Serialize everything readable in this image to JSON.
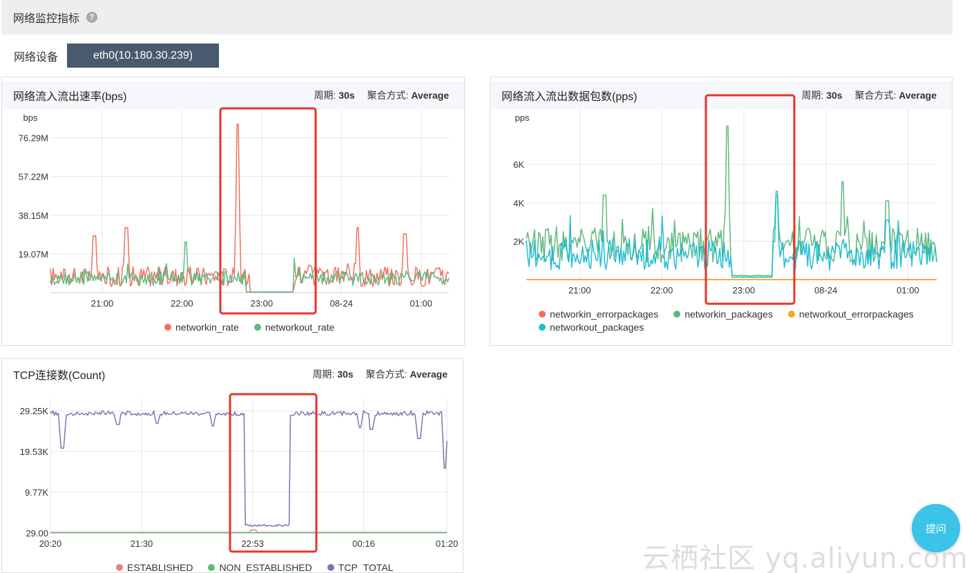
{
  "section": {
    "title": "网络监控指标",
    "help_icon": "question-circle-icon"
  },
  "device": {
    "label": "网络设备",
    "selected": "eth0(10.180.30.239)"
  },
  "panels": {
    "rate": {
      "title": "网络流入流出速率(bps)",
      "period_label": "周期:",
      "period": "30s",
      "agg_label": "聚合方式:",
      "agg": "Average",
      "legend": [
        {
          "name": "networkin_rate",
          "color": "#ef6f5e"
        },
        {
          "name": "networkout_rate",
          "color": "#5db97f"
        }
      ]
    },
    "packets": {
      "title": "网络流入流出数据包数(pps)",
      "period_label": "周期:",
      "period": "30s",
      "agg_label": "聚合方式:",
      "agg": "Average",
      "legend": [
        {
          "name": "networkin_errorpackages",
          "color": "#ef6f5e"
        },
        {
          "name": "networkin_packages",
          "color": "#5db97f"
        },
        {
          "name": "networkout_errorpackages",
          "color": "#f5a623"
        },
        {
          "name": "networkout_packages",
          "color": "#1fbcd2"
        }
      ]
    },
    "tcp": {
      "title": "TCP连接数(Count)",
      "period_label": "周期:",
      "period": "30s",
      "agg_label": "聚合方式:",
      "agg": "Average",
      "legend": [
        {
          "name": "ESTABLISHED",
          "color": "#ef7f7a"
        },
        {
          "name": "NON_ESTABLISHED",
          "color": "#5db97f"
        },
        {
          "name": "TCP_TOTAL",
          "color": "#8074b0"
        }
      ]
    }
  },
  "chart_data": [
    {
      "type": "line",
      "id": "rate",
      "ylabel": "bps",
      "y_ticks": [
        "76.29M",
        "57.22M",
        "38.15M",
        "19.07M"
      ],
      "y_tick_values": [
        76.29,
        57.22,
        38.15,
        19.07
      ],
      "ylim": [
        0,
        84
      ],
      "x_ticks": [
        "21:00",
        "22:00",
        "23:00",
        "08-24",
        "01:00"
      ],
      "x_tick_positions": [
        0.13,
        0.33,
        0.53,
        0.73,
        0.93
      ],
      "grid": true,
      "series": [
        {
          "name": "networkin_rate",
          "color": "#ef6f5e",
          "baseline": 8,
          "noise": 5,
          "spikes": [
            [
              0.11,
              28
            ],
            [
              0.19,
              32
            ],
            [
              0.47,
              83
            ],
            [
              0.77,
              32
            ],
            [
              0.89,
              29
            ]
          ],
          "dip": [
            0.5,
            0.61,
            0.3
          ]
        },
        {
          "name": "networkout_rate",
          "color": "#5db97f",
          "baseline": 7,
          "noise": 3.5,
          "spikes": [
            [
              0.34,
              25
            ],
            [
              0.61,
              17
            ]
          ],
          "dip": [
            0.49,
            0.61,
            0.3
          ]
        }
      ]
    },
    {
      "type": "line",
      "id": "packets",
      "ylabel": "pps",
      "y_ticks": [
        "6K",
        "4K",
        "2K"
      ],
      "y_tick_values": [
        6000,
        4000,
        2000
      ],
      "ylim": [
        0,
        8200
      ],
      "x_ticks": [
        "21:00",
        "22:00",
        "23:00",
        "08-24",
        "01:00"
      ],
      "x_tick_positions": [
        0.13,
        0.33,
        0.53,
        0.73,
        0.93
      ],
      "grid": true,
      "series": [
        {
          "name": "networkin_errorpackages",
          "color": "#ef6f5e",
          "constant": 0
        },
        {
          "name": "networkout_errorpackages",
          "color": "#f5a623",
          "constant": 0
        },
        {
          "name": "networkin_packages",
          "color": "#5db97f",
          "baseline": 1800,
          "noise": 900,
          "spikes": [
            [
              0.19,
              4400
            ],
            [
              0.49,
              8000
            ],
            [
              0.61,
              4600
            ],
            [
              0.77,
              5100
            ],
            [
              0.88,
              4100
            ]
          ],
          "dip": [
            0.5,
            0.6,
            180
          ]
        },
        {
          "name": "networkout_packages",
          "color": "#1fbcd2",
          "baseline": 1300,
          "noise": 800,
          "spikes": [
            [
              0.61,
              4400
            ],
            [
              0.88,
              3100
            ]
          ],
          "dip": [
            0.5,
            0.6,
            110
          ]
        }
      ]
    },
    {
      "type": "line",
      "id": "tcp",
      "y_ticks": [
        "29.25K",
        "19.53K",
        "9.77K",
        "29.00"
      ],
      "y_tick_values": [
        29250,
        19530,
        9770,
        29
      ],
      "ylim": [
        29,
        29250
      ],
      "x_ticks": [
        "20:20",
        "21:30",
        "22:53",
        "00:16",
        "01:20"
      ],
      "x_tick_positions": [
        0,
        0.23,
        0.51,
        0.79,
        1
      ],
      "grid": true,
      "series": [
        {
          "name": "ESTABLISHED",
          "color": "#ef7f7a",
          "constant": 150,
          "bump": [
            0.505,
            0.52,
            700
          ]
        },
        {
          "name": "NON_ESTABLISHED",
          "color": "#5db97f",
          "constant": 60
        },
        {
          "name": "TCP_TOTAL",
          "color": "#8074b0",
          "baseline": 28600,
          "noise": 500,
          "drops": [
            [
              0.03,
              20300
            ],
            [
              0.17,
              26000
            ],
            [
              0.27,
              26200
            ],
            [
              0.41,
              25600
            ],
            [
              0.78,
              25200
            ],
            [
              0.81,
              24800
            ],
            [
              0.93,
              22600
            ],
            [
              0.996,
              15500
            ]
          ],
          "dip": [
            0.49,
            0.605,
            1600
          ]
        }
      ]
    }
  ]
}
